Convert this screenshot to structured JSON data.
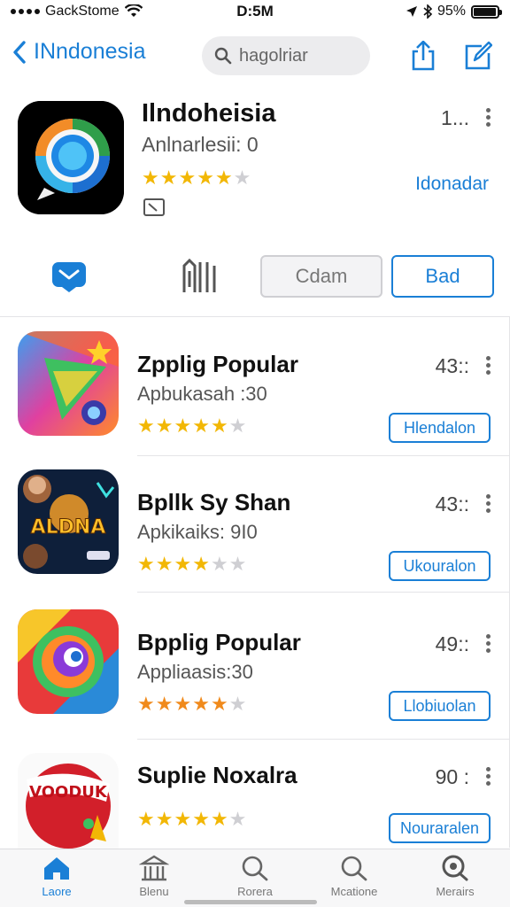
{
  "status_bar": {
    "carrier": "GackStome",
    "time": "D:5M",
    "battery": "95%",
    "battery_level": 0.95
  },
  "nav": {
    "back_label": "INndonesia",
    "search_placeholder": "hagolriar"
  },
  "featured": {
    "title": "Ilndoheisia",
    "subtitle": "Anlnarlesii: 0",
    "rating_stars": 4.5,
    "count": "1...",
    "link_label": "Idonadar"
  },
  "tabs": {
    "gray_button": "Cdam",
    "blue_button": "Bad"
  },
  "apps": [
    {
      "title": "Zpplig Popular",
      "subtitle": "Apbukasah :30",
      "rating_stars": 4.5,
      "count": "43::",
      "button_label": "Hlendalon"
    },
    {
      "title": "Bpllk Sy Shan",
      "subtitle": "Apkikaiks: 9I0",
      "rating_stars": 3.5,
      "count": "43::",
      "button_label": "Ukouralon",
      "icon_text": "ALDNA"
    },
    {
      "title": "Bpplig Popular",
      "subtitle": "Appliaasis:30",
      "rating_stars": 4.5,
      "count": "49::",
      "button_label": "Llobiuolan"
    },
    {
      "title": "Suplie Noxalra",
      "subtitle": "",
      "rating_stars": 4.5,
      "count": "90 :",
      "button_label": "Nouraralen",
      "icon_text": "VOODUK"
    }
  ],
  "tab_bar": [
    {
      "label": "Laore",
      "icon": "home-icon",
      "active": true
    },
    {
      "label": "Blenu",
      "icon": "building-icon",
      "active": false
    },
    {
      "label": "Rorera",
      "icon": "search-icon",
      "active": false
    },
    {
      "label": "Mcatione",
      "icon": "search-icon",
      "active": false
    },
    {
      "label": "Merairs",
      "icon": "search-icon",
      "active": false
    }
  ],
  "colors": {
    "accent": "#1a7fd6",
    "star": "#f2b705",
    "star_orange": "#f08a1c"
  }
}
